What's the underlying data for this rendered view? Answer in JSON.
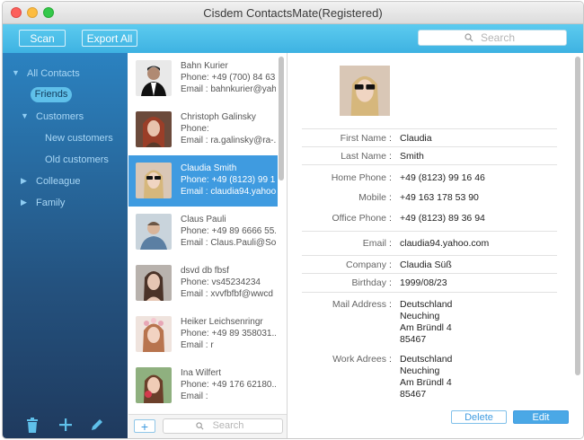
{
  "window": {
    "title": "Cisdem ContactsMate(Registered)"
  },
  "toolbar": {
    "scan_label": "Scan",
    "export_label": "Export All",
    "search_placeholder": "Search"
  },
  "sidebar": {
    "all_contacts": "All Contacts",
    "friends": "Friends",
    "customers": "Customers",
    "new_customers": "New customers",
    "old_customers": "Old customers",
    "colleague": "Colleague",
    "family": "Family",
    "footer_icons": [
      "trash-icon",
      "plus-icon",
      "pencil-icon"
    ]
  },
  "contacts": [
    {
      "name": "Bahn Kurier",
      "phone": "Phone: +49 (700) 84 63 ...",
      "email": "Email : bahnkurier@yah..."
    },
    {
      "name": "Christoph Galinsky",
      "phone": "Phone:",
      "email": "Email : ra.galinsky@ra-..."
    },
    {
      "name": "Claudia Smith",
      "phone": "Phone: +49 (8123) 99 1...",
      "email": "Email : claudia94.yahoo..."
    },
    {
      "name": "Claus Pauli",
      "phone": "Phone: +49 89 6666 55...",
      "email": "Email : Claus.Pauli@Sol..."
    },
    {
      "name": "dsvd db fbsf",
      "phone": "Phone: vs45234234",
      "email": "Email : xvvfbfbf@wwcd"
    },
    {
      "name": "Heiker Leichsenringr",
      "phone": "Phone: +49 89 358031...",
      "email": "Email : r"
    },
    {
      "name": "Ina Wilfert",
      "phone": "Phone: +49 176 62180...",
      "email": "Email :"
    }
  ],
  "list_footer": {
    "add_label": "+",
    "search_placeholder": "Search"
  },
  "detail": {
    "first_name_label": "First Name",
    "first_name": "Claudia",
    "last_name_label": "Last Name",
    "last_name": "Smith",
    "home_phone_label": "Home Phone",
    "home_phone": "+49 (8123) 99 16 46",
    "mobile_label": "Mobile",
    "mobile": "+49 163 178 53 90",
    "office_phone_label": "Office Phone",
    "office_phone": "+49 (8123) 89 36 94",
    "email_label": "Email",
    "email": "claudia94.yahoo.com",
    "company_label": "Company",
    "company": "Claudia Süß",
    "birthday_label": "Birthday",
    "birthday": "1999/08/23",
    "mail_address_label": "Mail Address",
    "mail_address": [
      "Deutschland",
      "Neuching",
      "Am Bründl 4",
      "85467"
    ],
    "work_address_label": "Work Adrees",
    "work_address": [
      "Deutschland",
      "Neuching",
      "Am Bründl 4",
      "85467"
    ],
    "colon": ":",
    "delete_label": "Delete",
    "edit_label": "Edit"
  },
  "colors": {
    "accent": "#3f9be0",
    "toolbar": "#4cc0ea",
    "sidebar": "#24527f"
  }
}
